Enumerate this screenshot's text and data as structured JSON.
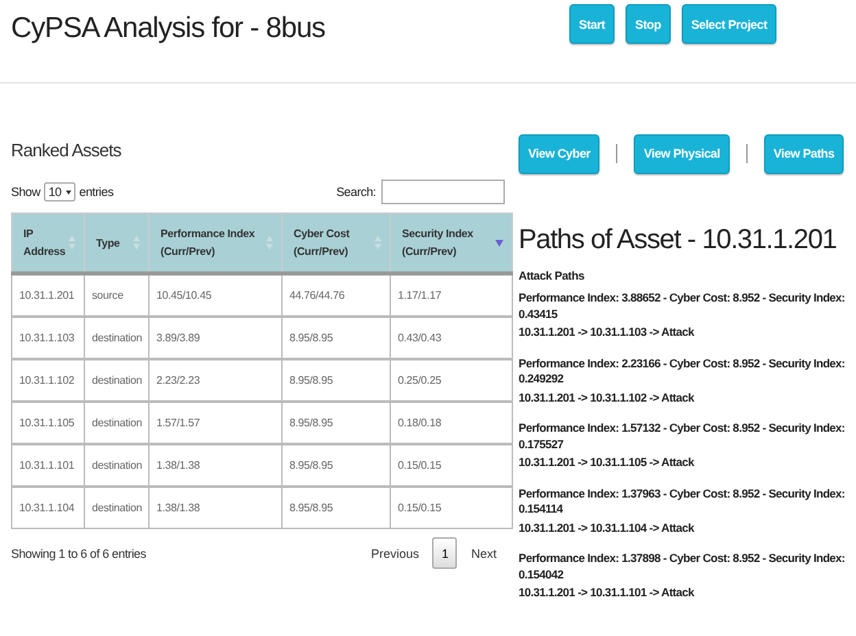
{
  "title": "CyPSA Analysis for - 8bus",
  "header_buttons": [
    "Start",
    "Stop",
    "Select Project"
  ],
  "ranked_assets": {
    "heading": "Ranked Assets",
    "length_menu": {
      "before": "Show",
      "value": "10",
      "after": "entries"
    },
    "search": {
      "label": "Search:"
    },
    "columns": [
      {
        "label": "IP Address",
        "sorted": false
      },
      {
        "label": "Type",
        "sorted": false
      },
      {
        "label": "Performance Index (Curr/Prev)",
        "sorted": false
      },
      {
        "label": "Cyber Cost (Curr/Prev)",
        "sorted": false
      },
      {
        "label": "Security Index (Curr/Prev)",
        "sorted": true
      }
    ],
    "rows": [
      [
        "10.31.1.201",
        "source",
        "10.45/10.45",
        "44.76/44.76",
        "1.17/1.17"
      ],
      [
        "10.31.1.103",
        "destination",
        "3.89/3.89",
        "8.95/8.95",
        "0.43/0.43"
      ],
      [
        "10.31.1.102",
        "destination",
        "2.23/2.23",
        "8.95/8.95",
        "0.25/0.25"
      ],
      [
        "10.31.1.105",
        "destination",
        "1.57/1.57",
        "8.95/8.95",
        "0.18/0.18"
      ],
      [
        "10.31.1.101",
        "destination",
        "1.38/1.38",
        "8.95/8.95",
        "0.15/0.15"
      ],
      [
        "10.31.1.104",
        "destination",
        "1.38/1.38",
        "8.95/8.95",
        "0.15/0.15"
      ]
    ],
    "info": "Showing 1 to 6 of 6 entries",
    "pagination": {
      "previous": "Previous",
      "pages": [
        {
          "label": "1",
          "selected": true
        }
      ],
      "next": "Next"
    }
  },
  "view_buttons": [
    "View Cyber",
    "View Physical",
    "View Paths"
  ],
  "paths": {
    "heading": "Paths of Asset - 10.31.1.201",
    "subheading": "Attack Paths",
    "items": [
      {
        "metrics": "Performance Index: 3.88652 - Cyber Cost: 8.952 - Security Index: 0.43415",
        "route": "10.31.1.201 -> 10.31.1.103 -> Attack"
      },
      {
        "metrics": "Performance Index: 2.23166 - Cyber Cost: 8.952 - Security Index: 0.249292",
        "route": "10.31.1.201 -> 10.31.1.102 -> Attack"
      },
      {
        "metrics": "Performance Index: 1.57132 - Cyber Cost: 8.952 - Security Index: 0.175527",
        "route": "10.31.1.201 -> 10.31.1.105 -> Attack"
      },
      {
        "metrics": "Performance Index: 1.37963 - Cyber Cost: 8.952 - Security Index: 0.154114",
        "route": "10.31.1.201 -> 10.31.1.104 -> Attack"
      },
      {
        "metrics": "Performance Index: 1.37898 - Cyber Cost: 8.952 - Security Index: 0.154042",
        "route": "10.31.1.201 -> 10.31.1.101 -> Attack"
      }
    ]
  }
}
